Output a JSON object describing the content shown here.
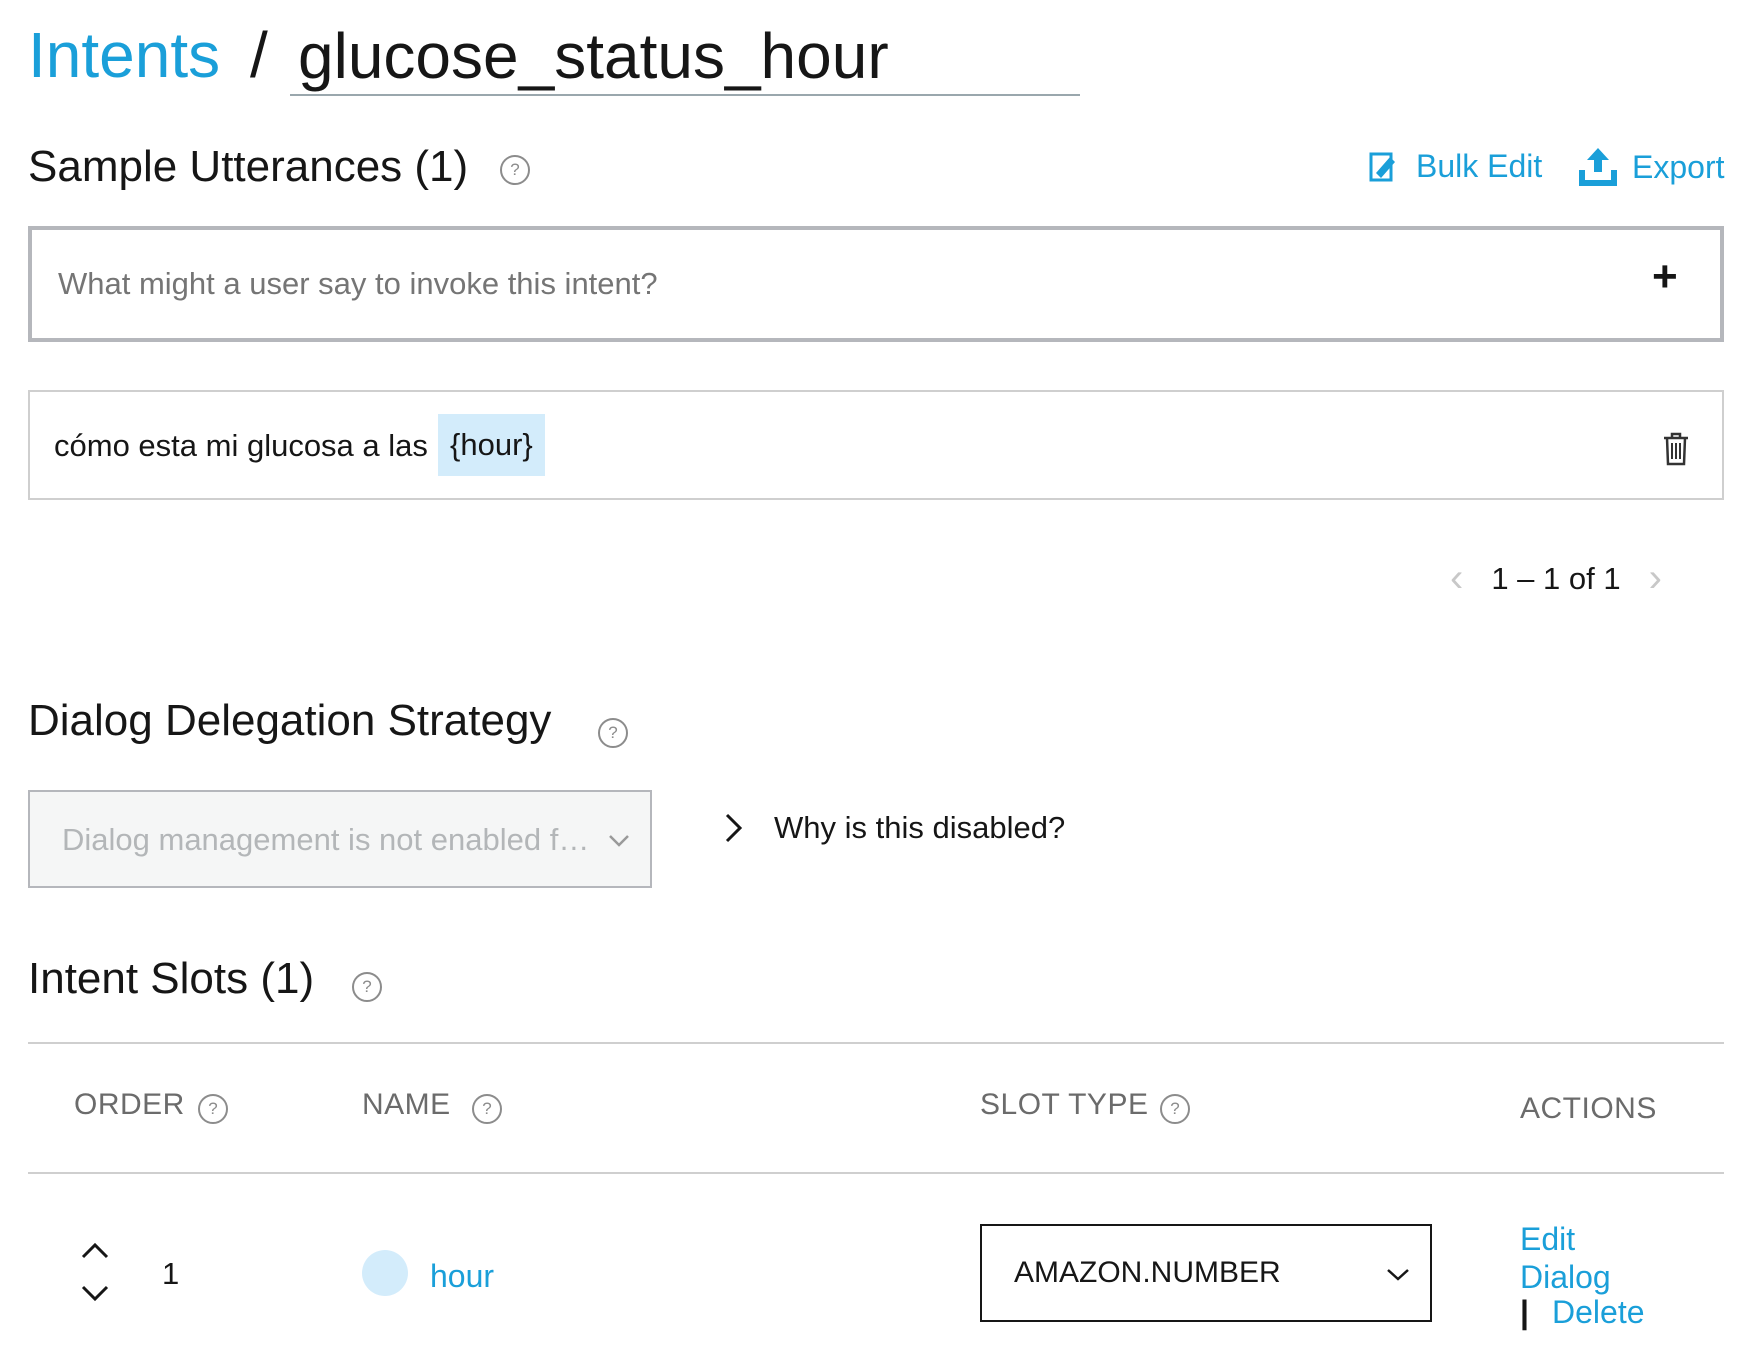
{
  "header": {
    "breadcrumb_root": "Intents",
    "separator": "/",
    "intent_name": "glucose_status_hour"
  },
  "utterances": {
    "title": "Sample Utterances (1)",
    "help": "?",
    "bulk_edit_label": "Bulk Edit",
    "export_label": "Export",
    "input_placeholder": "What might a user say to invoke this intent?",
    "add_symbol": "+",
    "items": [
      {
        "text": "cómo esta mi glucosa a las",
        "slot": "{hour}"
      }
    ],
    "pagination": "1 – 1 of 1"
  },
  "delegation": {
    "title": "Dialog Delegation Strategy",
    "help": "?",
    "select_value": "Dialog management is not enabled f…",
    "why_label": "Why is this disabled?"
  },
  "slots": {
    "title": "Intent Slots (1)",
    "help": "?",
    "columns": {
      "order": "ORDER",
      "name": "NAME",
      "slot_type": "SLOT TYPE",
      "actions": "ACTIONS"
    },
    "rows": [
      {
        "order": "1",
        "name": "hour",
        "slot_type": "AMAZON.NUMBER",
        "action_edit": "Edit",
        "action_dialog": "Dialog",
        "action_separator": "|",
        "action_delete": "Delete"
      }
    ]
  },
  "colors": {
    "accent": "#1a9fd9",
    "slot_highlight": "#d3ecfb",
    "text": "#161616",
    "muted": "#6b6b6b"
  }
}
